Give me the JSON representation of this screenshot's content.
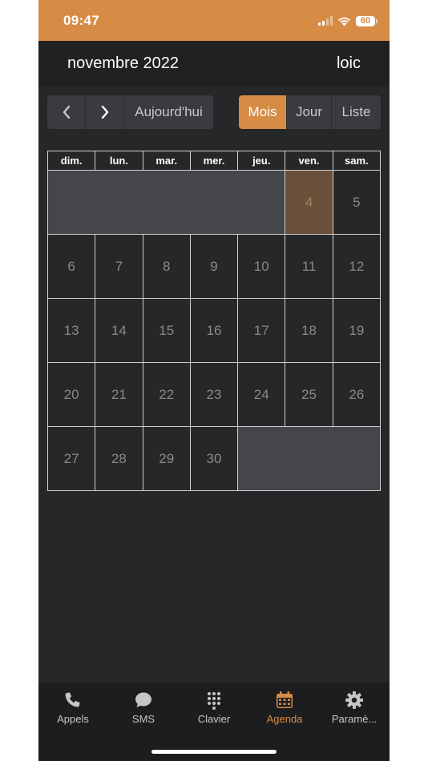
{
  "status_bar": {
    "time": "09:47",
    "battery": "60",
    "icons": [
      "signal-icon",
      "wifi-icon",
      "battery-icon"
    ]
  },
  "header": {
    "title": "novembre 2022",
    "user": "loic"
  },
  "toolbar": {
    "prev_icon": "chevron-left-icon",
    "next_icon": "chevron-right-icon",
    "today_label": "Aujourd'hui",
    "views": [
      "Mois",
      "Jour",
      "Liste"
    ],
    "active_view": "Mois"
  },
  "calendar": {
    "weekdays": [
      "dim.",
      "lun.",
      "mar.",
      "mer.",
      "jeu.",
      "ven.",
      "sam."
    ],
    "weeks": [
      [
        "",
        "",
        "",
        "",
        "",
        "4",
        "5"
      ],
      [
        "6",
        "7",
        "8",
        "9",
        "10",
        "11",
        "12"
      ],
      [
        "13",
        "14",
        "15",
        "16",
        "17",
        "18",
        "19"
      ],
      [
        "20",
        "21",
        "22",
        "23",
        "24",
        "25",
        "26"
      ],
      [
        "27",
        "28",
        "29",
        "30",
        "",
        "",
        ""
      ]
    ],
    "today": "4"
  },
  "tab_bar": {
    "items": [
      {
        "label": "Appels",
        "icon": "phone-icon"
      },
      {
        "label": "SMS",
        "icon": "chat-bubble-icon"
      },
      {
        "label": "Clavier",
        "icon": "keypad-icon"
      },
      {
        "label": "Agenda",
        "icon": "calendar-icon"
      },
      {
        "label": "Paramè...",
        "icon": "gear-icon"
      }
    ],
    "active": "Agenda"
  },
  "colors": {
    "accent": "#d68c45",
    "background": "#262729",
    "header_bg": "#202123",
    "empty_cell": "#45464a",
    "today_cell": "#6a5039"
  }
}
